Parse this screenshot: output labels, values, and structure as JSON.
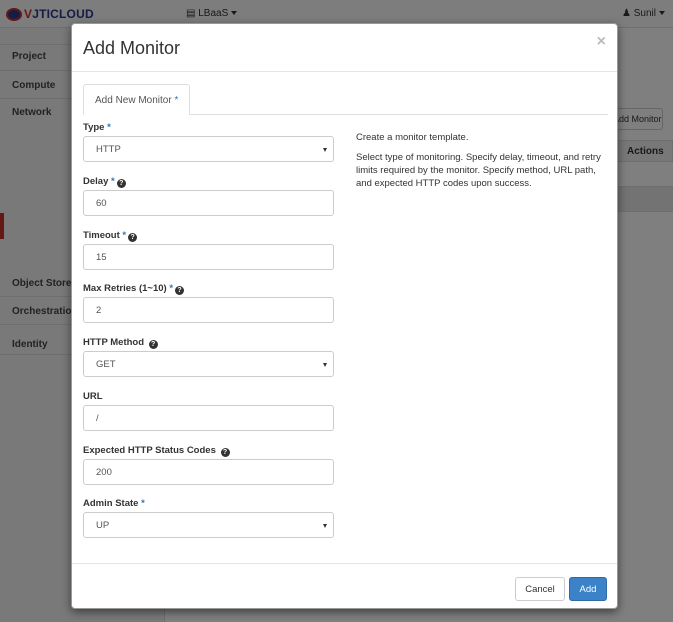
{
  "app": {
    "logo": {
      "part1": "V",
      "part2": "JTICLOUD"
    },
    "project_label": "LBaaS",
    "user_label": "Sunil"
  },
  "sidebar": {
    "items": [
      {
        "label": "Project"
      },
      {
        "label": "Compute"
      },
      {
        "label": "Network"
      },
      {
        "label": "Object Store"
      },
      {
        "label": "Orchestration"
      },
      {
        "label": "Identity"
      }
    ]
  },
  "main": {
    "add_button_label": "Add Monitor",
    "table_header": "Actions"
  },
  "modal": {
    "title": "Add Monitor",
    "close_glyph": "×",
    "tab_label": "Add New Monitor",
    "required_mark": "*",
    "fields": {
      "type": {
        "label": "Type",
        "value": "HTTP"
      },
      "delay": {
        "label": "Delay",
        "value": "60"
      },
      "timeout": {
        "label": "Timeout",
        "value": "15"
      },
      "max_retries": {
        "label": "Max Retries (1~10)",
        "value": "2"
      },
      "http_method": {
        "label": "HTTP Method",
        "value": "GET"
      },
      "url": {
        "label": "URL",
        "value": "/"
      },
      "expected_codes": {
        "label": "Expected HTTP Status Codes",
        "value": "200"
      },
      "admin_state": {
        "label": "Admin State",
        "value": "UP"
      }
    },
    "help": {
      "p1": "Create a monitor template.",
      "p2": "Select type of monitoring. Specify delay, timeout, and retry limits required by the monitor. Specify method, URL path, and expected HTTP codes upon success."
    },
    "footer": {
      "cancel_label": "Cancel",
      "add_label": "Add"
    }
  },
  "icons": {
    "help": "question-circle-icon",
    "user": "user-icon",
    "project": "server-icon",
    "dropdown": "chevron-down-icon"
  },
  "colors": {
    "primary": "#3c82c8",
    "required": "#3276b1",
    "sidebar_active": "#c9302c",
    "brand": "#2b3a8f"
  }
}
